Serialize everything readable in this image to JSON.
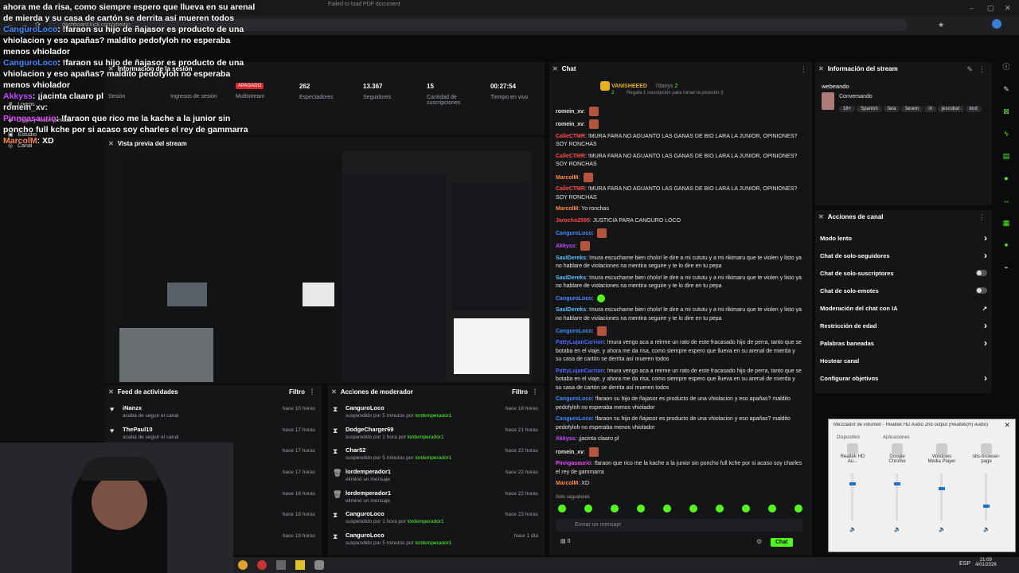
{
  "browser": {
    "url": "dashboard.kick.com/stream",
    "tab_title": "Failed to load PDF document"
  },
  "overlay_chat": [
    {
      "user": "",
      "text": "ahora me da risa, como siempre espero que llueva en su arenal de mierda y su casa de cartón se derrita así mueren todos"
    },
    {
      "user": "CanguroLoco",
      "text": ": !faraon su hijo de ñajasor es producto de una vhiolacion y eso apañas? maldito pedofyloh no esperaba menos vhiolador"
    },
    {
      "user": "CanguroLoco",
      "text": ": !faraon su hijo de ñajasor es producto de una vhiolacion y eso apañas? maldito pedofyloh no esperaba menos vhiolador"
    },
    {
      "user": "Akkyss",
      "text": ": ¡jacinta claaro pl"
    },
    {
      "user": "romein_xv",
      "text": ":"
    },
    {
      "user": "Pinngasaurio",
      "text": ": !faraon que rico me la kache a la junior sin poncho full kche por si acaso soy charles el rey de gammarra"
    },
    {
      "user": "MarcolM",
      "text": ": XD"
    }
  ],
  "sidebar": {
    "items": [
      "Estudio",
      "Canal",
      "Drops y recompensas",
      "Logros"
    ]
  },
  "session": {
    "title": "Información de la sesión",
    "status_badge": "APAGADO",
    "stats": [
      {
        "label": "Sesión",
        "value": ""
      },
      {
        "label": "Ingresos de sesión",
        "value": ""
      },
      {
        "label": "Multistream",
        "value": ""
      },
      {
        "label": "Espectadores",
        "value": "262"
      },
      {
        "label": "Seguidores",
        "value": "13.367"
      },
      {
        "label": "Cantidad de suscripciones",
        "value": "15"
      },
      {
        "label": "Tiempo en vivo",
        "value": "00:27:54"
      }
    ]
  },
  "preview": {
    "title": "Vista previa del stream"
  },
  "activity_feed": {
    "title": "Feed de actividades",
    "filter": "Filtro",
    "rows": [
      {
        "name": "iNanzx",
        "sub": "acaba de seguir el canal",
        "time": "hace 10 horas"
      },
      {
        "name": "ThePaul10",
        "sub": "acaba de seguir el canal",
        "time": "hace 17 horas"
      },
      {
        "name": "",
        "sub": "",
        "time": "hace 17 horas"
      },
      {
        "name": "",
        "sub": "",
        "time": "hace 17 horas"
      },
      {
        "name": "",
        "sub": "",
        "time": "hace 18 horas"
      },
      {
        "name": "",
        "sub": "",
        "time": "hace 18 horas"
      },
      {
        "name": "",
        "sub": "",
        "time": "hace 19 horas"
      }
    ]
  },
  "mod_actions": {
    "title": "Acciones de moderador",
    "filter": "Filtro",
    "rows": [
      {
        "name": "CanguroLoco",
        "sub": "suspendido por 5 minutos por",
        "mod": "lordemperador1",
        "time": "hace 18 horas"
      },
      {
        "name": "DodgeCharger69",
        "sub": "suspendido por 1 hora por",
        "mod": "lordemperador1",
        "time": "hace 21 horas"
      },
      {
        "name": "Char52",
        "sub": "suspendido por 5 minutos por",
        "mod": "lordemperador1",
        "time": "hace 22 horas"
      },
      {
        "name": "lordemperador1",
        "sub": "eliminó un mensaje",
        "mod": "",
        "time": "hace 22 horas"
      },
      {
        "name": "lordemperador1",
        "sub": "eliminó un mensaje",
        "mod": "",
        "time": "hace 22 horas"
      },
      {
        "name": "CanguroLoco",
        "sub": "suspendido por 1 hora por",
        "mod": "lordemperador1",
        "time": "hace 23 horas"
      },
      {
        "name": "CanguroLoco",
        "sub": "suspendido por 5 minutos por",
        "mod": "lordemperador1",
        "time": "hace 1 día"
      }
    ]
  },
  "chat": {
    "title": "Chat",
    "pinned_user": "VANISHEEED",
    "pinned_count": "2",
    "pinned_user2": "7danys",
    "pinned_count2": "2",
    "gift_text": "Regala 1 suscripción para tomar la posición 3",
    "followers_only": "Solo seguidores",
    "input_placeholder": "Enviar un mensaje",
    "points": "0",
    "send_label": "Chat",
    "messages": [
      {
        "user": "romein_xv",
        "color": "#e5e5e5",
        "text": "",
        "emote": "red"
      },
      {
        "user": "romein_xv",
        "color": "#e5e5e5",
        "text": "",
        "emote": "red"
      },
      {
        "user": "CalleCTMR",
        "color": "#ff4b4b",
        "text": "!MURA FARA NO AGUANTO LAS GANAS DE BIO LARA LA JUNIOR, OPINIONES? SOY RONCHAS",
        "emote": ""
      },
      {
        "user": "CalleCTMR",
        "color": "#ff4b4b",
        "text": "!MURA FARA NO AGUANTO LAS GANAS DE BIO LARA LA JUNIOR, OPINIONES? SOY RONCHAS",
        "emote": ""
      },
      {
        "user": "MarcolM",
        "color": "#ff8a3d",
        "text": "",
        "emote": "red"
      },
      {
        "user": "CalleCTMR",
        "color": "#ff4b4b",
        "text": "!MURA FARA NO AGUANTO LAS GANAS DE BIO LARA LA JUNIOR, OPINIONES? SOY RONCHAS",
        "emote": ""
      },
      {
        "user": "MarcolM",
        "color": "#ff8a3d",
        "text": "Yo ronchas",
        "emote": ""
      },
      {
        "user": "Jarocho2595",
        "color": "#ff4b4b",
        "text": "JUSTICIA PARA CANGURO LOCO",
        "emote": ""
      },
      {
        "user": "CanguroLoco",
        "color": "#3e8bff",
        "text": "",
        "emote": "red"
      },
      {
        "user": "Akkyss",
        "color": "#c84bff",
        "text": "",
        "emote": "red"
      },
      {
        "user": "SaulDereks",
        "color": "#5ec1ff",
        "text": "!mura escuchame bien cholo! le dire a mi cututu y a mi rikimaru que te violen y listo ya no hablare de violaciones na mentira seguire y te lo dire en tu pepa",
        "emote": ""
      },
      {
        "user": "SaulDereks",
        "color": "#5ec1ff",
        "text": "!mura escuchame bien cholo! le dire a mi cututu y a mi rikimaru que te violen y listo ya no hablare de violaciones na mentira seguire y te lo dire en tu pepa",
        "emote": ""
      },
      {
        "user": "CanguroLoco",
        "color": "#3e8bff",
        "text": "",
        "emote": "green"
      },
      {
        "user": "SaulDereks",
        "color": "#5ec1ff",
        "text": "!mura escuchame bien cholo! le dire a mi cututu y a mi rikimaru que te violen y listo ya no hablare de violaciones na mentira seguire y te lo dire en tu pepa",
        "emote": ""
      },
      {
        "user": "CanguroLoco",
        "color": "#3e8bff",
        "text": "",
        "emote": "red"
      },
      {
        "user": "PattyLujanCarrion",
        "color": "#4f6bff",
        "text": "!mura vengo aca a reirme un rato de este fracasado hijo de perra, tanto que se botaba en el viaje, y ahora me da risa, como siempre espero que llueva en su arenal de mierda y su casa de cartón se derrita así mueren todos",
        "emote": ""
      },
      {
        "user": "PattyLujanCarrion",
        "color": "#4f6bff",
        "text": "!mura vengo aca a reirme un rato de este fracasado hijo de perra, tanto que se botaba en el viaje, y ahora me da risa, como siempre espero que llueva en su arenal de mierda y su casa de cartón se derrita así mueren todos",
        "emote": ""
      },
      {
        "user": "CanguroLoco",
        "color": "#3e8bff",
        "text": "!faraon su hijo de ñajasor es producto de una vhiolacion y eso apañas? maldito pedofyloh no esperaba menos vhiolador",
        "emote": ""
      },
      {
        "user": "CanguroLoco",
        "color": "#3e8bff",
        "text": "!faraon su hijo de ñajasor es producto de una vhiolacion y eso apañas? maldito pedofyloh no esperaba menos vhiolador",
        "emote": ""
      },
      {
        "user": "Akkyss",
        "color": "#c84bff",
        "text": "¡jacinta claaro pl",
        "emote": ""
      },
      {
        "user": "romein_xv",
        "color": "#e5e5e5",
        "text": "",
        "emote": "red"
      },
      {
        "user": "Pinngasaurio",
        "color": "#e94bff",
        "text": "!faraon que rico me la kache a la junior sin poncho full kche por si acaso soy charles el rey de gammarra",
        "emote": ""
      },
      {
        "user": "MarcolM",
        "color": "#ff8a3d",
        "text": "XD",
        "emote": ""
      }
    ]
  },
  "stream_info": {
    "title": "Información del stream",
    "stream_title": "webeando",
    "category": "Conversando",
    "tags": [
      "18+",
      "Spanish",
      "fara",
      "faraon",
      "irl",
      "jescobar",
      "lord"
    ]
  },
  "channel_actions": {
    "title": "Acciones de canal",
    "items": [
      {
        "label": "Modo lento",
        "control": "arrow"
      },
      {
        "label": "Chat de solo-seguidores",
        "control": "arrow"
      },
      {
        "label": "Chat de solo-suscriptores",
        "control": "toggle"
      },
      {
        "label": "Chat de solo-emotes",
        "control": "toggle"
      },
      {
        "label": "Moderación del chat con IA",
        "control": "link"
      },
      {
        "label": "Restricción de edad",
        "control": "arrow"
      },
      {
        "label": "Palabras baneadas",
        "control": "arrow"
      },
      {
        "label": "Hostear canal",
        "control": "none"
      },
      {
        "label": "Configurar objetivos",
        "control": "arrow"
      }
    ]
  },
  "mixer": {
    "title": "Mezclador de volumen - Realtek HD Audio 2nd output (Realtek(R) Audio)",
    "device_label": "Dispositivo",
    "apps_label": "Aplicaciones",
    "channels": [
      {
        "name": "Realtek HD Au...",
        "level": 0.8
      },
      {
        "name": "Google Chrome",
        "level": 0.8
      },
      {
        "name": "Windows Media Player",
        "level": 0.7
      },
      {
        "name": "obs-browser-page",
        "level": 0.3
      }
    ]
  },
  "taskbar": {
    "lang": "ESP",
    "time": "21:09",
    "date": "4/01/2026"
  },
  "colors": {
    "accent": "#53fc18",
    "panel": "#141517",
    "badge_red": "#e0282e"
  }
}
